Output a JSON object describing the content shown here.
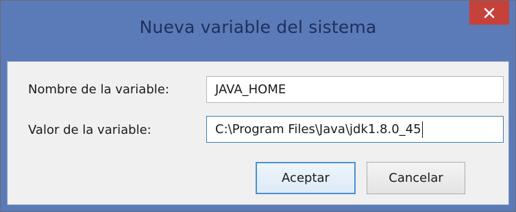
{
  "window": {
    "title": "Nueva variable del sistema",
    "close_glyph": "✕"
  },
  "form": {
    "name_label": "Nombre de la variable:",
    "name_value": "JAVA_HOME",
    "value_label": "Valor de la variable:",
    "value_value": "C:\\Program Files\\Java\\jdk1.8.0_45"
  },
  "buttons": {
    "accept_label": "Aceptar",
    "cancel_label": "Cancelar"
  },
  "colors": {
    "frame": "#5a7ab8",
    "close": "#c7413b",
    "client": "#f0f0f0",
    "focus": "#3c7fb1"
  },
  "icons": {
    "close": "close-icon"
  }
}
